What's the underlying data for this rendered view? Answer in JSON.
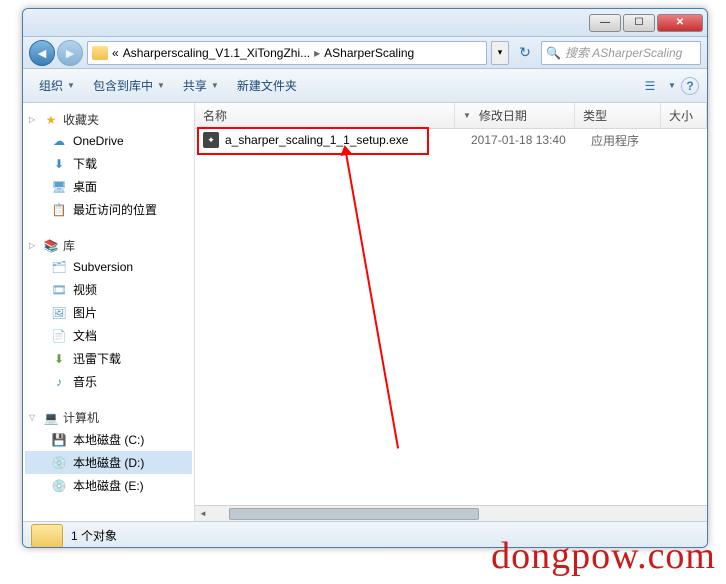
{
  "titlebar": {
    "min": "—",
    "max": "☐",
    "close": "✕"
  },
  "breadcrumb": {
    "folder_sep1": "«",
    "path1": "Asharperscaling_V1.1_XiTongZhi...",
    "sep": "▸",
    "path2": "ASharperScaling",
    "drop": "▾"
  },
  "nav": {
    "back": "◄",
    "forward": "►",
    "refresh": "↻"
  },
  "search": {
    "icon": "🔍",
    "placeholder": "搜索 ASharperScaling"
  },
  "toolbar": {
    "organize": "组织",
    "include": "包含到库中",
    "share": "共享",
    "newfolder": "新建文件夹",
    "drop": "▼",
    "view_icon": "☰",
    "view_drop": "▼",
    "help": "?"
  },
  "sidebar": {
    "favorites": {
      "label": "收藏夹",
      "tri": "▷",
      "icon": "★"
    },
    "onedrive": {
      "label": "OneDrive",
      "icon": "☁"
    },
    "downloads": {
      "label": "下载",
      "icon": "⬇"
    },
    "desktop": {
      "label": "桌面",
      "icon": "🖥"
    },
    "recent": {
      "label": "最近访问的位置",
      "icon": "📋"
    },
    "libraries": {
      "label": "库",
      "tri": "▷",
      "icon": "📚"
    },
    "svn": {
      "label": "Subversion",
      "icon": "🗂"
    },
    "videos": {
      "label": "视频",
      "icon": "🎞"
    },
    "pictures": {
      "label": "图片",
      "icon": "🖼"
    },
    "documents": {
      "label": "文档",
      "icon": "📄"
    },
    "xunlei": {
      "label": "迅雷下载",
      "icon": "⬇"
    },
    "music": {
      "label": "音乐",
      "icon": "♪"
    },
    "computer": {
      "label": "计算机",
      "tri": "▽",
      "icon": "💻"
    },
    "drive_c": {
      "label": "本地磁盘 (C:)",
      "icon": "💾"
    },
    "drive_d": {
      "label": "本地磁盘 (D:)",
      "icon": "💿"
    },
    "drive_e": {
      "label": "本地磁盘 (E:)",
      "icon": "💿"
    }
  },
  "columns": {
    "name": "名称",
    "date": "修改日期",
    "type": "类型",
    "size": "大小",
    "sort": "▼"
  },
  "files": [
    {
      "name": "a_sharper_scaling_1_1_setup.exe",
      "date": "2017-01-18 13:40",
      "type": "应用程序",
      "icon": "✦"
    }
  ],
  "status": {
    "count": "1 个对象"
  },
  "watermark": "dongpow.com"
}
